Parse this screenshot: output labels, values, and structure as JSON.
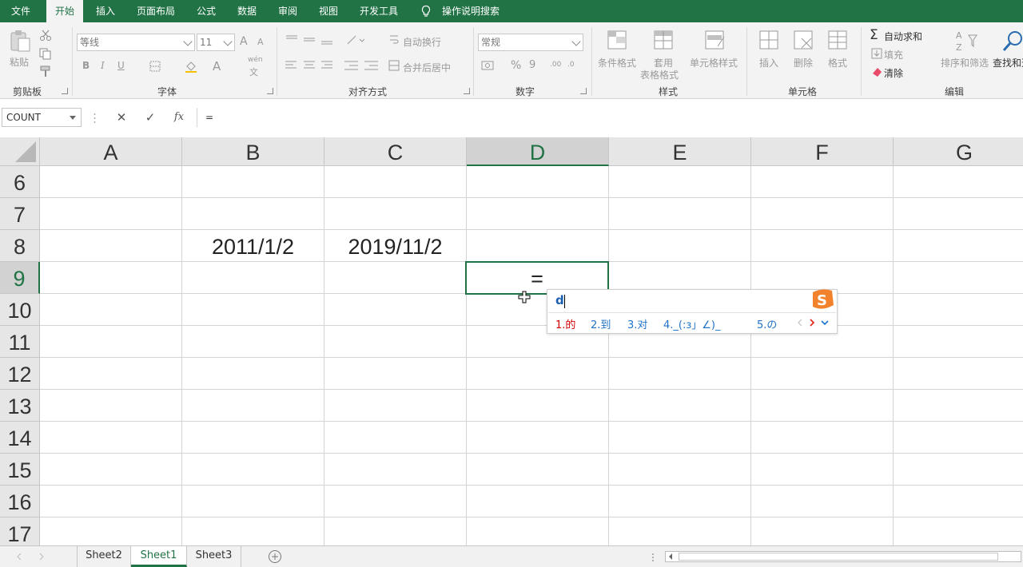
{
  "ribbon_tabs": [
    "文件",
    "开始",
    "插入",
    "页面布局",
    "公式",
    "数据",
    "审阅",
    "视图",
    "开发工具"
  ],
  "active_tab": "开始",
  "help_search": "操作说明搜索",
  "clipboard": {
    "paste": "粘贴",
    "group": "剪贴板"
  },
  "font": {
    "name": "等线",
    "size": "11",
    "bold": "B",
    "italic": "I",
    "underline": "U",
    "grow": "A",
    "shrink": "A",
    "color_a": "A",
    "wen": "wén",
    "wen_char": "文",
    "group": "字体"
  },
  "alignment": {
    "wrap": "自动换行",
    "merge": "合并后居中",
    "group": "对齐方式"
  },
  "number": {
    "format": "常规",
    "percent": "%",
    "comma": "9",
    "inc_dec": ".00",
    "dec_dec": ".0",
    "group": "数字"
  },
  "styles": {
    "conditional": "条件格式",
    "table_line1": "套用",
    "table_line2": "表格格式",
    "cell_styles": "单元格样式",
    "group": "样式"
  },
  "cells": {
    "insert": "插入",
    "delete": "删除",
    "format": "格式",
    "group": "单元格"
  },
  "editing": {
    "autosum": "自动求和",
    "fill": "填充",
    "clear": "清除",
    "sort": "排序和筛选",
    "find": "查找和选",
    "group": "编辑"
  },
  "formula_bar": {
    "name_box": "COUNT",
    "cancel": "✕",
    "enter": "✓",
    "fx": "fx",
    "formula": "="
  },
  "columns": [
    "A",
    "B",
    "C",
    "D",
    "E",
    "F",
    "G"
  ],
  "selected_column": "D",
  "rows": [
    "6",
    "7",
    "8",
    "9",
    "10",
    "11",
    "12",
    "13",
    "14",
    "15",
    "16",
    "17"
  ],
  "selected_row": "9",
  "cells_data": {
    "B8": "2011/1/2",
    "C8": "2019/11/2",
    "D9": "="
  },
  "ime": {
    "input": "d",
    "candidates": [
      "1.的",
      "2.到",
      "3.对",
      "4._(:з」∠)_",
      "5.の"
    ]
  },
  "sheets": [
    "Sheet2",
    "Sheet1",
    "Sheet3"
  ],
  "active_sheet": "Sheet1",
  "add_sheet": "+",
  "colors": {
    "accent": "#217346",
    "ime_first": "#d40000",
    "ime_other": "#1e73c8"
  }
}
